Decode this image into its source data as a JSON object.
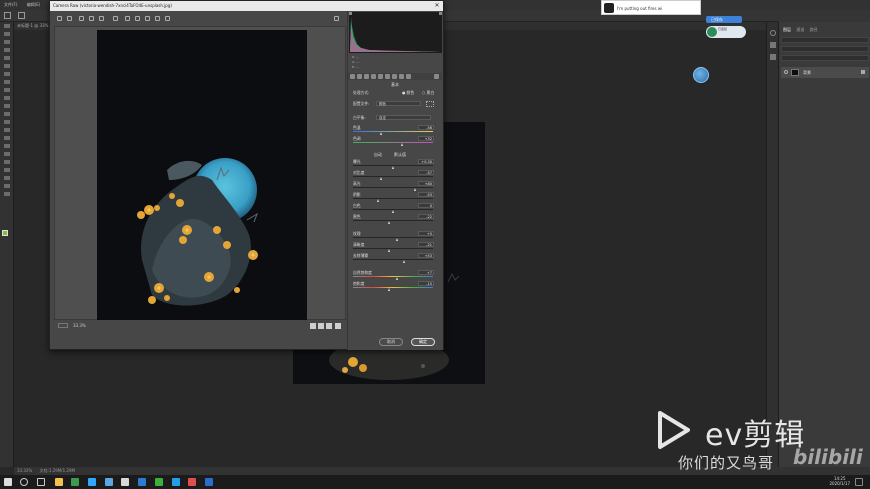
{
  "app": {
    "menu": [
      "文件(F)",
      "编辑(E)"
    ],
    "doc_tab": "未标题-1 @ 33%",
    "status_left": "33.33%",
    "status_doc": "文档:1.29M/1.29M"
  },
  "camera_raw": {
    "title": "Camera Raw (victoria-wendish-7xnci4TaFO4E-unsplash.jpg)",
    "close_glyph": "✕",
    "zoom": "33.3%",
    "histogram_meta": [
      "R: ---",
      "G: ---",
      "B: ---"
    ],
    "panel_title": "基本",
    "process_label": "处理方式:",
    "process_options": [
      "颜色",
      "黑白"
    ],
    "profile_label": "配置文件:",
    "profile_value": "颜色",
    "wb_label": "白平衡:",
    "wb_value": "自定",
    "auto_label": "自动",
    "default_label": "默认值",
    "sliders_wb": [
      {
        "label": "色温",
        "value": "-56",
        "pos": 0.36
      },
      {
        "label": "色调",
        "value": "+32",
        "pos": 0.62
      }
    ],
    "sliders_tone": [
      {
        "label": "曝光",
        "value": "+0.30",
        "pos": 0.5
      },
      {
        "label": "对比度",
        "value": "-57",
        "pos": 0.36
      },
      {
        "label": "高光",
        "value": "+80",
        "pos": 0.78
      },
      {
        "label": "阴影",
        "value": "-53",
        "pos": 0.32
      },
      {
        "label": "白色",
        "value": "0",
        "pos": 0.5
      },
      {
        "label": "黑色",
        "value": "-22",
        "pos": 0.46
      }
    ],
    "sliders_presence": [
      {
        "label": "纹理",
        "value": "+5",
        "pos": 0.55
      },
      {
        "label": "清晰度",
        "value": "-21",
        "pos": 0.45
      },
      {
        "label": "去除薄雾",
        "value": "+53",
        "pos": 0.64
      }
    ],
    "sliders_color": [
      {
        "label": "自然饱和度",
        "value": "+7",
        "pos": 0.55
      },
      {
        "label": "饱和度",
        "value": "-15",
        "pos": 0.46
      }
    ],
    "cancel_label": "取消",
    "ok_label": "确定"
  },
  "layers_panel": {
    "tabs": [
      "图层",
      "通道",
      "路径"
    ],
    "layer_name": "背景"
  },
  "overlays": {
    "music_text": "I'm putting out fires wi",
    "chip_badge": "已保存",
    "chip_text": "已连接"
  },
  "watermark": {
    "brand": "ev剪辑",
    "subtitle": "你们的又鸟哥",
    "bili": "bilibili"
  },
  "taskbar": {
    "time": "14:25",
    "date": "2020/1/17"
  },
  "colors": {
    "accent_blue": "#3a9fc7",
    "flower_yellow": "#e3a535",
    "moon_blue": "#4ab3cf"
  }
}
